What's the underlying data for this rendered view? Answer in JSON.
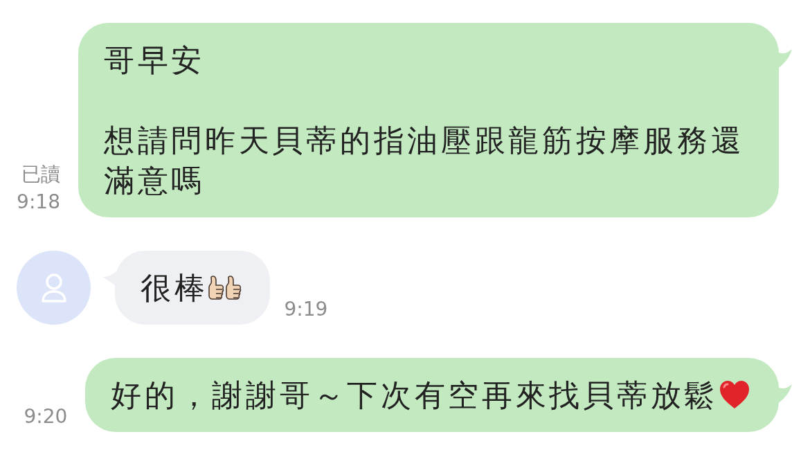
{
  "messages": [
    {
      "kind": "outgoing",
      "paragraphs": [
        "哥早安",
        "想請問昨天貝蒂的指油壓跟龍筋按摩服務還滿意嗎"
      ],
      "read_label": "已讀",
      "time": "9:18"
    },
    {
      "kind": "incoming",
      "paragraphs": [
        "很棒"
      ],
      "emoji": [
        {
          "kind": "thumbs-up"
        },
        {
          "kind": "thumbs-up"
        }
      ],
      "time": "9:19"
    },
    {
      "kind": "outgoing",
      "paragraphs": [
        "好的，謝謝哥～下次有空再來找貝蒂放鬆"
      ],
      "emoji": [
        {
          "kind": "heart"
        }
      ],
      "time": "9:20"
    }
  ]
}
